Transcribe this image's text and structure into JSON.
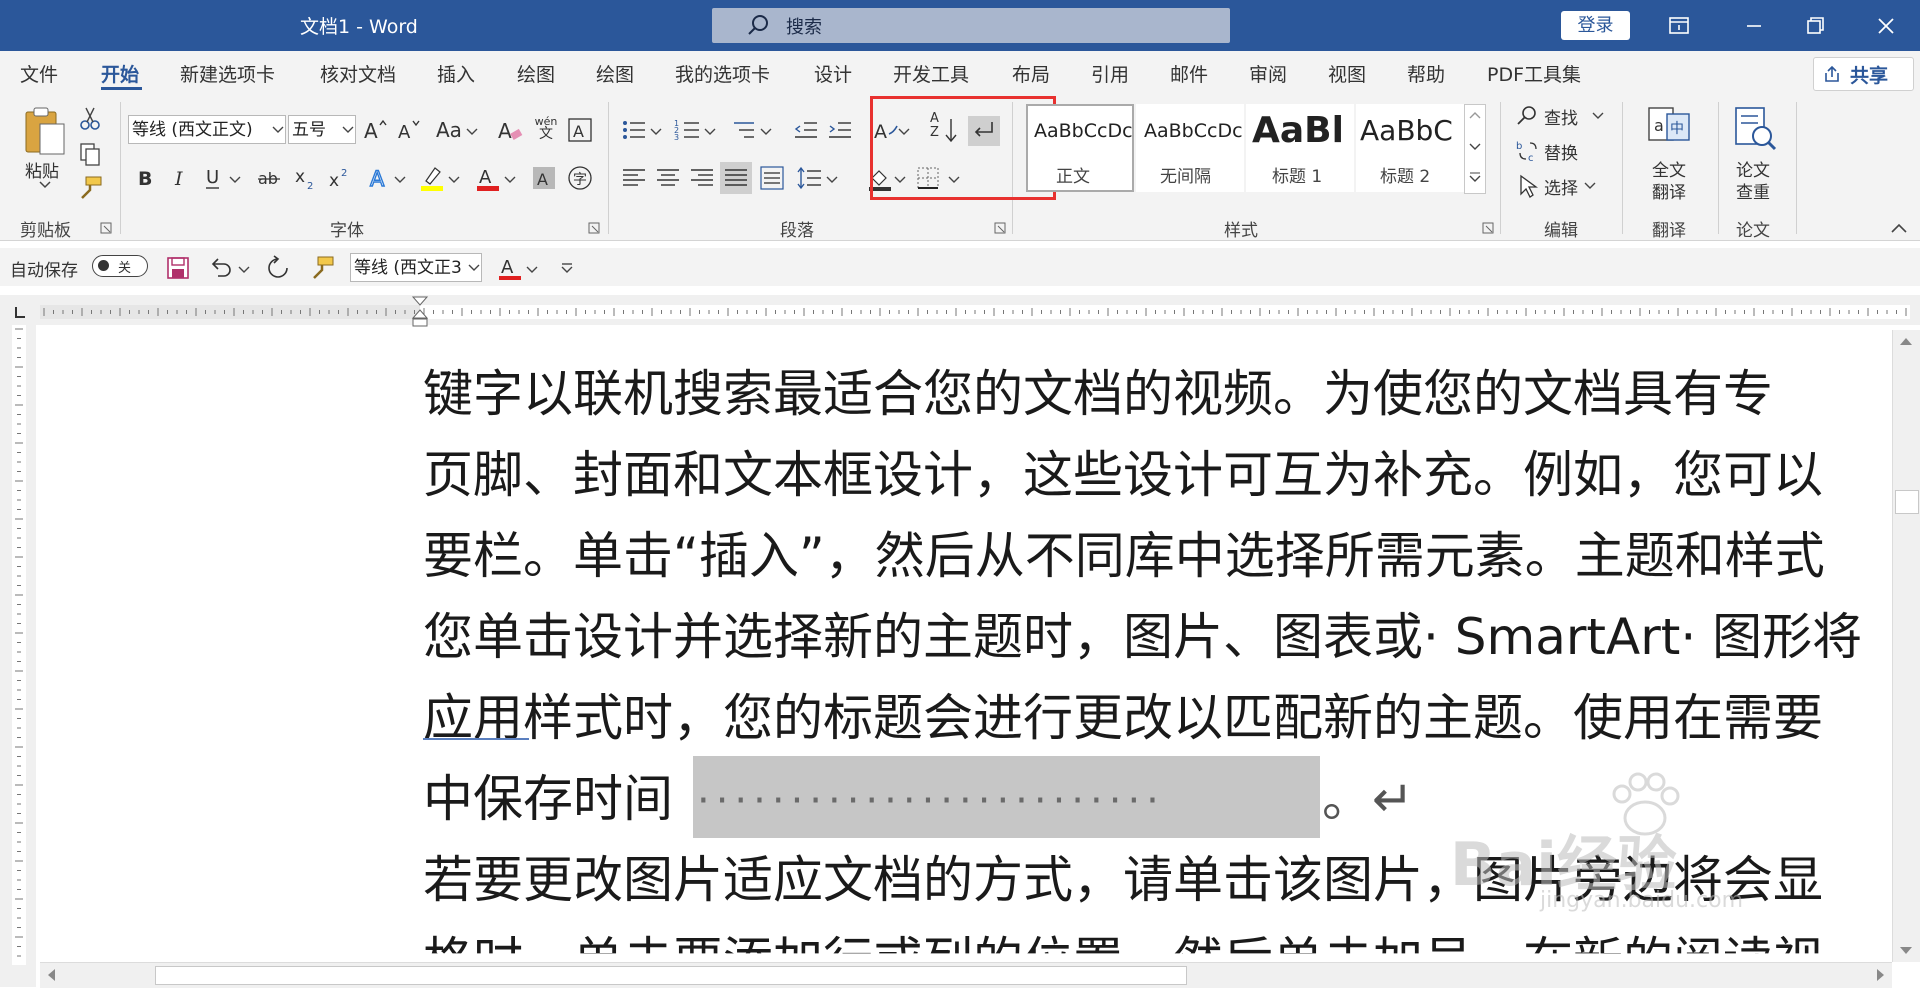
{
  "window": {
    "title": "文档1  -  Word",
    "search_placeholder": "搜索",
    "login_label": "登录",
    "accent": "#2b579a"
  },
  "tabs": [
    "文件",
    "开始",
    "新建选项卡",
    "核对文档",
    "插入",
    "绘图",
    "绘图",
    "我的选项卡",
    "设计",
    "开发工具",
    "布局",
    "引用",
    "邮件",
    "审阅",
    "视图",
    "帮助",
    "PDF工具集"
  ],
  "active_tab": "开始",
  "share_label": "共享",
  "ribbon": {
    "clipboard": {
      "paste": "粘贴",
      "group": "剪贴板"
    },
    "font": {
      "font_name": "等线 (西文正文)",
      "font_size": "五号",
      "group": "字体",
      "wen_top": "wén",
      "wen_bottom": "文",
      "aa_label": "Aa"
    },
    "paragraph": {
      "group": "段落",
      "sort_top": "A",
      "sort_bottom": "Z"
    },
    "styles": {
      "group": "样式",
      "items": [
        {
          "sample": "AaBbCcDc",
          "name": "正文"
        },
        {
          "sample": "AaBbCcDc",
          "name": "无间隔"
        },
        {
          "sample": "AaBl",
          "name": "标题 1"
        },
        {
          "sample": "AaBbC",
          "name": "标题 2"
        }
      ]
    },
    "editing": {
      "find": "查找",
      "replace": "替换",
      "select": "选择",
      "group": "编辑"
    },
    "translate": {
      "label_line1": "全文",
      "label_line2": "翻译",
      "group": "翻译"
    },
    "paper": {
      "label_line1": "论文",
      "label_line2": "查重",
      "group": "论文"
    }
  },
  "qat": {
    "autosave_label": "自动保存",
    "autosave_state": "关",
    "font_name": "等线 (西文正3"
  },
  "document": {
    "lines": [
      "键字以联机搜索最适合您的文档的视频。为使您的文档具有专",
      "页脚、封面和文本框设计，这些设计可互为补充。例如，您可以",
      "要栏。单击“插入”，然后从不同库中选择所需元素。主题和样式",
      "您单击设计并选择新的主题时，图片、图表或· SmartArt· 图形将",
      "应用样式时，您的标题会进行更改以匹配新的主题。使用在需要",
      "中保存时间",
      "若要更改图片适应文档的方式，请单击该图片，图片旁边将会显",
      "格时，单击要添加行或列的位置，然后单击加号。在新的阅读视"
    ],
    "line6_tail": "。↵",
    "dots": "·························"
  },
  "watermark": {
    "text": "Bai经验",
    "sub": "jingyan.baidu.com"
  }
}
